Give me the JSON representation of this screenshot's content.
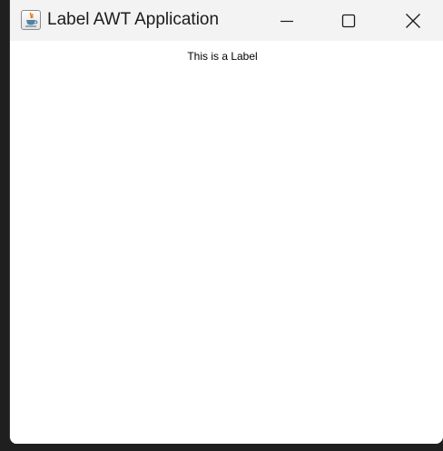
{
  "window": {
    "title": "Label AWT Application",
    "app_icon": "java-coffee-cup-icon",
    "controls": {
      "minimize_icon": "minimize-icon",
      "maximize_icon": "maximize-icon",
      "close_icon": "close-icon"
    }
  },
  "content": {
    "label_text": "This is a Label"
  },
  "colors": {
    "titlebar": "#f3f3f3",
    "content_background": "#ffffff",
    "desktop_background": "#1f1f1f",
    "java_cup_orange": "#e76f00",
    "java_cup_blue": "#5382a1"
  }
}
